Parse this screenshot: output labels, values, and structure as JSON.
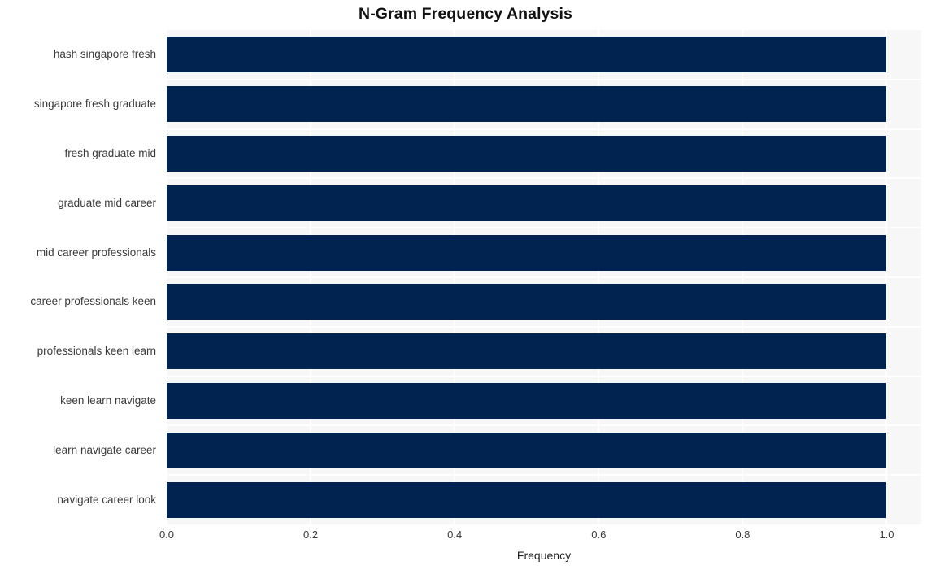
{
  "chart_data": {
    "type": "bar",
    "orientation": "horizontal",
    "title": "N-Gram Frequency Analysis",
    "xlabel": "Frequency",
    "ylabel": "",
    "categories": [
      "hash singapore fresh",
      "singapore fresh graduate",
      "fresh graduate mid",
      "graduate mid career",
      "mid career professionals",
      "career professionals keen",
      "professionals keen learn",
      "keen learn navigate",
      "learn navigate career",
      "navigate career look"
    ],
    "values": [
      1.0,
      1.0,
      1.0,
      1.0,
      1.0,
      1.0,
      1.0,
      1.0,
      1.0,
      1.0
    ],
    "xlim": [
      0.0,
      1.048
    ],
    "xticks": [
      0.0,
      0.2,
      0.4,
      0.6,
      0.8,
      1.0
    ],
    "xtick_labels": [
      "0.0",
      "0.2",
      "0.4",
      "0.6",
      "0.8",
      "1.0"
    ],
    "grid": true,
    "legend": null,
    "bar_color": "#00244f",
    "plot_background": "#f7f7f7",
    "grid_color": "#ffffff",
    "figure_background": "#ffffff"
  }
}
